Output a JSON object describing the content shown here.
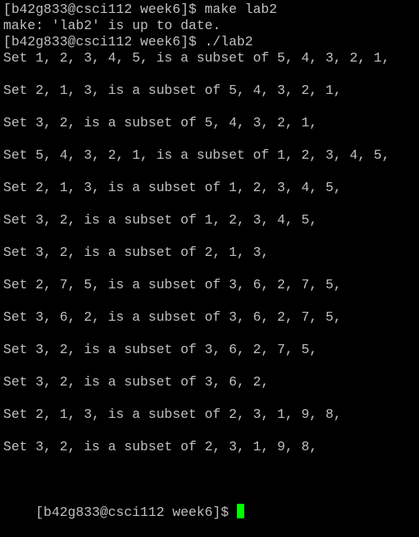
{
  "terminal": {
    "lines": [
      "[b42g833@csci112 week6]$ make lab2",
      "make: 'lab2' is up to date.",
      "[b42g833@csci112 week6]$ ./lab2",
      "Set 1, 2, 3, 4, 5, is a subset of 5, 4, 3, 2, 1,",
      "",
      "Set 2, 1, 3, is a subset of 5, 4, 3, 2, 1,",
      "",
      "Set 3, 2, is a subset of 5, 4, 3, 2, 1,",
      "",
      "Set 5, 4, 3, 2, 1, is a subset of 1, 2, 3, 4, 5,",
      "",
      "Set 2, 1, 3, is a subset of 1, 2, 3, 4, 5,",
      "",
      "Set 3, 2, is a subset of 1, 2, 3, 4, 5,",
      "",
      "Set 3, 2, is a subset of 2, 1, 3,",
      "",
      "Set 2, 7, 5, is a subset of 3, 6, 2, 7, 5,",
      "",
      "Set 3, 6, 2, is a subset of 3, 6, 2, 7, 5,",
      "",
      "Set 3, 2, is a subset of 3, 6, 2, 7, 5,",
      "",
      "Set 3, 2, is a subset of 3, 6, 2,",
      "",
      "Set 2, 1, 3, is a subset of 2, 3, 1, 9, 8,",
      "",
      "Set 3, 2, is a subset of 2, 3, 1, 9, 8,",
      "",
      ""
    ],
    "prompt": "[b42g833@csci112 week6]$ ",
    "colors": {
      "background": "#000000",
      "text": "#c0c0c0",
      "cursor": "#00ff00"
    }
  }
}
